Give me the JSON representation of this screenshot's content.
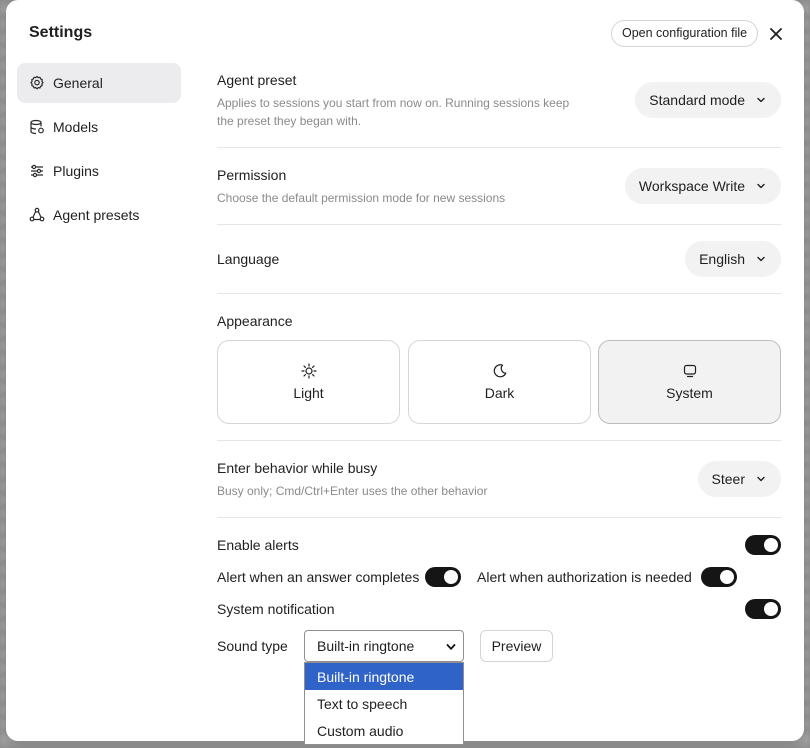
{
  "dialog": {
    "title": "Settings",
    "open_config_label": "Open configuration file",
    "close_icon": "close-icon"
  },
  "sidebar": {
    "items": [
      {
        "label": "General",
        "icon": "gear-icon",
        "active": true
      },
      {
        "label": "Models",
        "icon": "database-icon",
        "active": false
      },
      {
        "label": "Plugins",
        "icon": "sliders-icon",
        "active": false
      },
      {
        "label": "Agent presets",
        "icon": "agent-icon",
        "active": false
      }
    ]
  },
  "agent_preset": {
    "title": "Agent preset",
    "desc": "Applies to sessions you start from now on. Running sessions keep the preset they began with.",
    "value": "Standard mode"
  },
  "permission": {
    "title": "Permission",
    "desc": "Choose the default permission mode for new sessions",
    "value": "Workspace Write"
  },
  "language": {
    "title": "Language",
    "value": "English"
  },
  "appearance": {
    "title": "Appearance",
    "options": [
      {
        "label": "Light",
        "icon": "sun-icon"
      },
      {
        "label": "Dark",
        "icon": "moon-icon"
      },
      {
        "label": "System",
        "icon": "monitor-icon"
      }
    ],
    "selected": "System"
  },
  "enter_behavior": {
    "title": "Enter behavior while busy",
    "desc": "Busy only; Cmd/Ctrl+Enter uses the other behavior",
    "value": "Steer"
  },
  "alerts": {
    "enable_label": "Enable alerts",
    "enable_on": true,
    "answer_label": "Alert when an answer completes",
    "answer_on": true,
    "auth_label": "Alert when authorization is needed",
    "auth_on": true,
    "system_notification_label": "System notification",
    "system_notification_on": true,
    "sound_type_label": "Sound type",
    "sound_type_value": "Built-in ringtone",
    "sound_options": [
      "Built-in ringtone",
      "Text to speech",
      "Custom audio"
    ],
    "preview_label": "Preview"
  },
  "colors": {
    "accent_highlight": "#2f63c7",
    "toggle_on": "#151515",
    "active_bg": "#ececef"
  }
}
